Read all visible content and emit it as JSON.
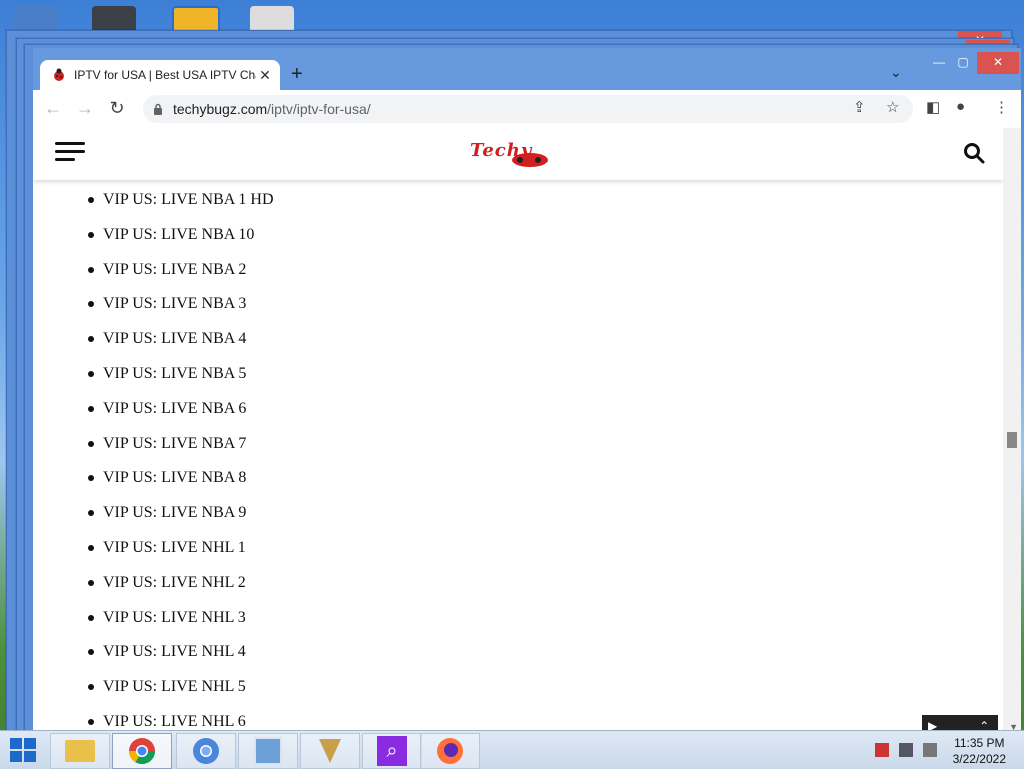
{
  "browser": {
    "tab_title": "IPTV for USA | Best USA IPTV Cha",
    "tab_close": "✕",
    "new_tab": "+",
    "tab_search": "⌄",
    "url_host": "techybugz.com",
    "url_path": "/iptv/iptv-for-usa/",
    "window_controls": {
      "minimize": "—",
      "maximize": "▢",
      "close": "✕"
    }
  },
  "site": {
    "logo_text": "Techy"
  },
  "channels": [
    "VIP US: LIVE NBA 1 HD",
    "VIP US: LIVE NBA 10",
    "VIP US: LIVE NBA 2",
    "VIP US: LIVE NBA 3",
    "VIP US: LIVE NBA 4",
    "VIP US: LIVE NBA 5",
    "VIP US: LIVE NBA 6",
    "VIP US: LIVE NBA 7",
    "VIP US: LIVE NBA 8",
    "VIP US: LIVE NBA 9",
    "VIP US: LIVE NHL 1",
    "VIP US: LIVE NHL 2",
    "VIP US: LIVE NHL 3",
    "VIP US: LIVE NHL 4",
    "VIP US: LIVE NHL 5",
    "VIP US: LIVE NHL 6"
  ],
  "taskbar": {
    "apps": [
      "file-explorer-icon",
      "chrome-icon",
      "chromium-icon",
      "control-panel-icon",
      "app-icon",
      "search-app-icon",
      "firefox-icon"
    ],
    "time": "11:35 PM",
    "date": "3/22/2022"
  },
  "colors": {
    "logo_red": "#d21f1f",
    "browser_frame": "#6699de",
    "close_red": "#d9534f"
  }
}
